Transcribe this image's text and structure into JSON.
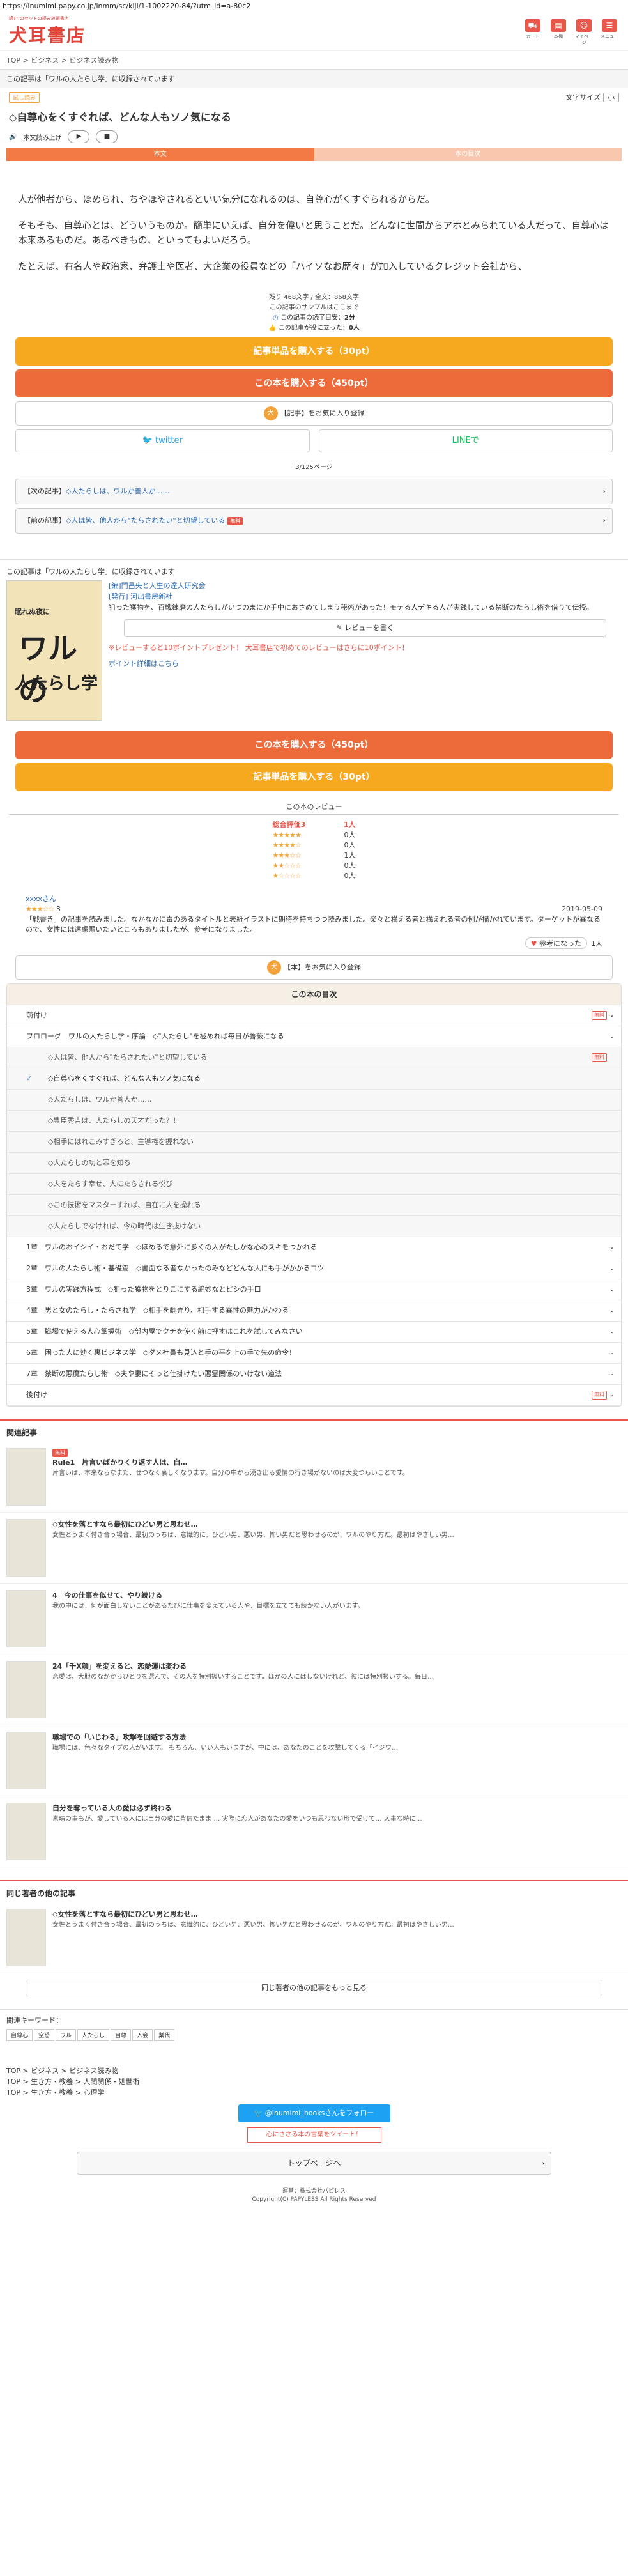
{
  "browser": {
    "url": "https://inumimi.papy.co.jp/inmm/sc/kiji/1-1002220-84/?utm_id=a-80c2"
  },
  "header": {
    "tagline": "読む!のセットの読み放題書店",
    "logo": "犬耳書店",
    "icons": [
      {
        "name": "cart-icon",
        "label": "カート"
      },
      {
        "name": "bookmark-icon",
        "label": "本棚"
      },
      {
        "name": "mypage-icon",
        "label": "マイページ"
      },
      {
        "name": "menu-icon",
        "label": "メニュー"
      }
    ]
  },
  "breadcrumb": "TOP > ビジネス > ビジネス読み物",
  "collection_notice": "この記事は「ワルの人たらし学」に収録されています",
  "article": {
    "sample_badge": "試し読み",
    "font_size_label": "文字サイズ",
    "font_size_value": "小",
    "title": "自尊心をくすぐれば、どんな人もソノ気になる",
    "read_aloud_label": "本文読み上げ",
    "play_icon": "▶",
    "stop_icon": "■",
    "tabs": [
      "本文",
      "本の目次"
    ],
    "paragraphs": [
      "人が他者から、ほめられ、ちやほやされるといい気分になれるのは、自尊心がくすぐられるからだ。",
      "そもそも、自尊心とは、どういうものか。簡単にいえば、自分を偉いと思うことだ。どんなに世間からアホとみられている人だって、自尊心は本来あるものだ。あるべきもの、といってもよいだろう。",
      "たとえば、有名人や政治家、弁護士や医者、大企業の役員などの「ハイソなお歴々」が加入しているクレジット会社から、"
    ]
  },
  "stats": {
    "chars": "残り 468文字 / 全文：868文字",
    "sample_note": "この記事のサンプルはここまで",
    "read_time_label": "この記事の読了目安：",
    "read_time": "2分",
    "likes_label": "この記事が役に立った：",
    "likes": "0人"
  },
  "actions": {
    "buy_article": "記事単品を購入する（30pt）",
    "buy_book": "この本を購入する（450pt）",
    "fav_article": "【記事】をお気に入り登録",
    "twitter": "twitter",
    "line": "LINEで"
  },
  "pager": "3/125ページ",
  "nav": {
    "next_prefix": "【次の記事】",
    "next_title": "◇人たらしは、ワルか善人か……",
    "prev_prefix": "【前の記事】",
    "prev_title": "◇人は皆、他人から\"たらされたい\"と切望している",
    "free_badge": "無料"
  },
  "book": {
    "notice": "この記事は「ワルの人たらし学」に収録されています",
    "cover_top": "眠れぬ夜に",
    "cover_main": "ワルの",
    "cover_sub": "人たらし学",
    "category": "[編]門昌央と人生の達人研究会",
    "publisher": "[発行] 河出書房新社",
    "description": "狙った獲物を、百戦錬磨の人たらしがいつのまにか手中におさめてしまう秘術があった！モテる人デキる人が実践している禁断のたらし術を借りて伝授。",
    "review_btn": "レビューを書く",
    "promo_1": "※レビューすると10ポイントプレゼント！ 犬耳書店で初めてのレビューはさらに10ポイント！",
    "promo_2": "ポイント詳細はこちら",
    "buy_book": "この本を購入する（450pt）",
    "buy_article": "記事単品を購入する（30pt）"
  },
  "reviews": {
    "heading": "この本のレビュー",
    "overall_label": "総合評価3",
    "overall_count": "1人",
    "rows": [
      {
        "stars": "★★★★★",
        "count": "0人"
      },
      {
        "stars": "★★★★☆",
        "count": "0人"
      },
      {
        "stars": "★★★☆☆",
        "count": "1人"
      },
      {
        "stars": "★★☆☆☆",
        "count": "0人"
      },
      {
        "stars": "★☆☆☆☆",
        "count": "0人"
      }
    ],
    "user": "xxxxさん",
    "user_stars": "★★★☆☆",
    "user_rating": "3",
    "date": "2019-05-09",
    "text": "「戦書き」の記事を読みました。なかなかに毒のあるタイトルと表紙イラストに期待を持ちつつ読みました。楽々と構える者と構えれる者の例が描かれています。ターゲットが異なるので、女性には遠慮願いたいところもありましたが、参考になりました。",
    "helpful_btn": "参考になった",
    "helpful_count": "1人"
  },
  "fav_book": "【本】をお気に入り登録",
  "toc": {
    "heading": "この本の目次",
    "items": [
      {
        "label": "前付け",
        "free": "無料",
        "type": "chapter"
      },
      {
        "label": "プロローグ　ワルの人たらし学・序論　◇\"人たらし\"を極めれば毎日が薔薇になる",
        "type": "chapter-open"
      },
      {
        "label": "◇人は皆、他人から\"たらされたい\"と切望している",
        "free": "無料",
        "type": "sub"
      },
      {
        "label": "◇自尊心をくすぐれば、どんな人もソノ気になる",
        "type": "sub-current"
      },
      {
        "label": "◇人たらしは、ワルか善人か……",
        "type": "sub"
      },
      {
        "label": "◇豊臣秀吉は、人たらしの天才だった？！",
        "type": "sub"
      },
      {
        "label": "◇相手にはれこみすぎると、主導権を握れない",
        "type": "sub"
      },
      {
        "label": "◇人たらしの功と罪を知る",
        "type": "sub"
      },
      {
        "label": "◇人をたらす幸せ、人にたらされる悦び",
        "type": "sub"
      },
      {
        "label": "◇この技術をマスターすれば、自在に人を操れる",
        "type": "sub"
      },
      {
        "label": "◇人たらしでなければ、今の時代は生き抜けない",
        "type": "sub"
      },
      {
        "label": "1章　ワルのおイシイ・おだて学　◇ほめるで意外に多くの人がたしかな心のスキをつかれる",
        "type": "chapter"
      },
      {
        "label": "2章　ワルの人たらし術・基礎篇　◇書面なる者なかったのみなどどんな人にも手がかかるコツ",
        "type": "chapter"
      },
      {
        "label": "3章　ワルの実践方程式　◇狙った獲物をとりこにする絶妙なとピシの手口",
        "type": "chapter"
      },
      {
        "label": "4章　男と女のたらし・たらされ学　◇相手を翻弄り、相手する異性の魅力がかわる",
        "type": "chapter"
      },
      {
        "label": "5章　職場で使える人心掌握術　◇部内屋でクチを使く前に押すはこれを試してみなさい",
        "type": "chapter"
      },
      {
        "label": "6章　困った人に効く裏ビジネス学　◇ダメ社員も見込と手の平を上の手で先の命令！",
        "type": "chapter"
      },
      {
        "label": "7章　禁断の悪魔たらし術　◇夫や妻にそっと仕掛けたい悪霊関係のいけない道法",
        "type": "chapter"
      },
      {
        "label": "後付け",
        "free": "無料",
        "type": "chapter"
      }
    ]
  },
  "related": {
    "heading": "関連記事",
    "items": [
      {
        "badge": "無料",
        "title": "Rule1　片言いばかりくり返す人は、自…",
        "desc": "片言いは、本来ならなまた、せつなく哀しくなります。自分の中から湧き出る愛情の行き場がないのは大変つらいことです。"
      },
      {
        "title": "◇女性を落とすなら最初にひどい男と思わせ…",
        "desc": "女性とうまく付き合う場合、最初のうちは、意識的に、ひどい男、悪い男、怖い男だと思わせるのが、ワルのやり方だ。最初はやさしい男…"
      },
      {
        "title": "4　今の仕事を似せて、やり続ける",
        "desc": "我の中には、何が面白しないことがあるたびに仕事を変えている人や、目標を立てても続かない人がいます。"
      },
      {
        "title": "24「千X顔」を変えると、恋愛運は変わる",
        "desc": "恋愛は、大胆のなかからひとりを選んで、その人を特別扱いすることです。ほかの人にはしないけれど、彼には特別扱いする。毎日…"
      },
      {
        "title": "職場での「いじわる」攻撃を回避する方法",
        "desc": "職場には、色々なタイプの人がいます。 もちろん、いい人もいますが、中には、あなたのことを攻撃してくる「イジワ…"
      },
      {
        "title": "自分を奪っている人の愛は必ず終わる",
        "desc": "素晴の事もが、愛している人には自分の愛に背信たまま … 実際に恋人があなたの愛をいつも思わない形で受けて… 大事な時に…"
      }
    ]
  },
  "same_author": {
    "heading": "同じ著者の他の記事",
    "items": [
      {
        "title": "◇女性を落とすなら最初にひどい男と思わせ…",
        "desc": "女性とうまく付き合う場合、最初のうちは、意識的に、ひどい男、悪い男、怖い男だと思わせるのが、ワルのやり方だ。最初はやさしい男…"
      }
    ],
    "more": "同じ著者の他の記事をもっと見る"
  },
  "keywords": {
    "label": "関連キーワード：",
    "chips": [
      "自尊心",
      "空恐",
      "ワル",
      "人たらし",
      "自尊",
      "入会",
      "業代"
    ]
  },
  "footer": {
    "crumbs": [
      "TOP > ビジネス > ビジネス読み物",
      "TOP > 生き方・教養 > 人間関係・処世術",
      "TOP > 生き方・教養 > 心理学"
    ],
    "follow": "@inumimi_booksさんをフォロー",
    "tweet": "心にささる本の言葉をツイート！",
    "top_btn": "トップページへ",
    "operator": "運営：株式会社パピレス",
    "copyright": "Copyright(C) PAPYLESS All Rights Reserved"
  }
}
